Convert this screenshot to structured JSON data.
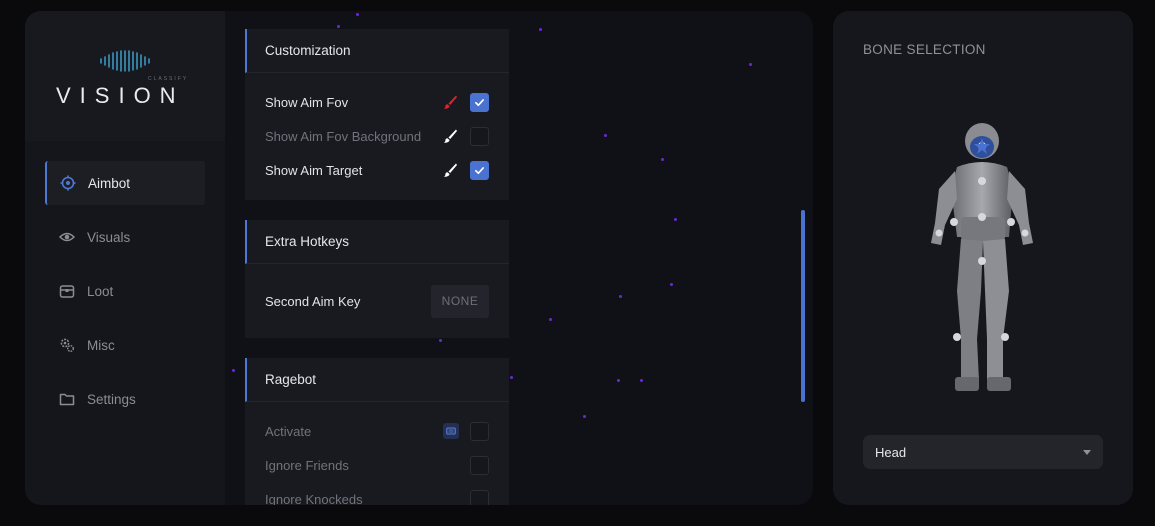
{
  "brand": {
    "sub": "CLASSIFY",
    "word": "VISION"
  },
  "nav": [
    {
      "label": "Aimbot",
      "icon": "crosshair-icon",
      "active": true
    },
    {
      "label": "Visuals",
      "icon": "eye-icon",
      "active": false
    },
    {
      "label": "Loot",
      "icon": "chest-icon",
      "active": false
    },
    {
      "label": "Misc",
      "icon": "gears-icon",
      "active": false
    },
    {
      "label": "Settings",
      "icon": "folder-icon",
      "active": false
    }
  ],
  "customization": {
    "title": "Customization",
    "rows": [
      {
        "label": "Show Aim Fov",
        "checked": true,
        "brush_color": "#e0242a"
      },
      {
        "label": "Show Aim Fov Background",
        "checked": false,
        "brush_color": "#ffffff"
      },
      {
        "label": "Show Aim Target",
        "checked": true,
        "brush_color": "#ffffff"
      }
    ]
  },
  "extra_hotkeys": {
    "title": "Extra Hotkeys",
    "rows": [
      {
        "label": "Second Aim Key",
        "key": "NONE"
      }
    ]
  },
  "ragebot": {
    "title": "Ragebot",
    "rows": [
      {
        "label": "Activate",
        "checked": false
      },
      {
        "label": "Ignore Friends",
        "checked": false
      },
      {
        "label": "Ignore Knockeds",
        "checked": false
      }
    ]
  },
  "bone_selection": {
    "title": "BONE SELECTION",
    "selected": "Head"
  },
  "colors": {
    "accent": "#4a72d0",
    "particle": "#6a28d8",
    "panel_bg": "#101116"
  }
}
